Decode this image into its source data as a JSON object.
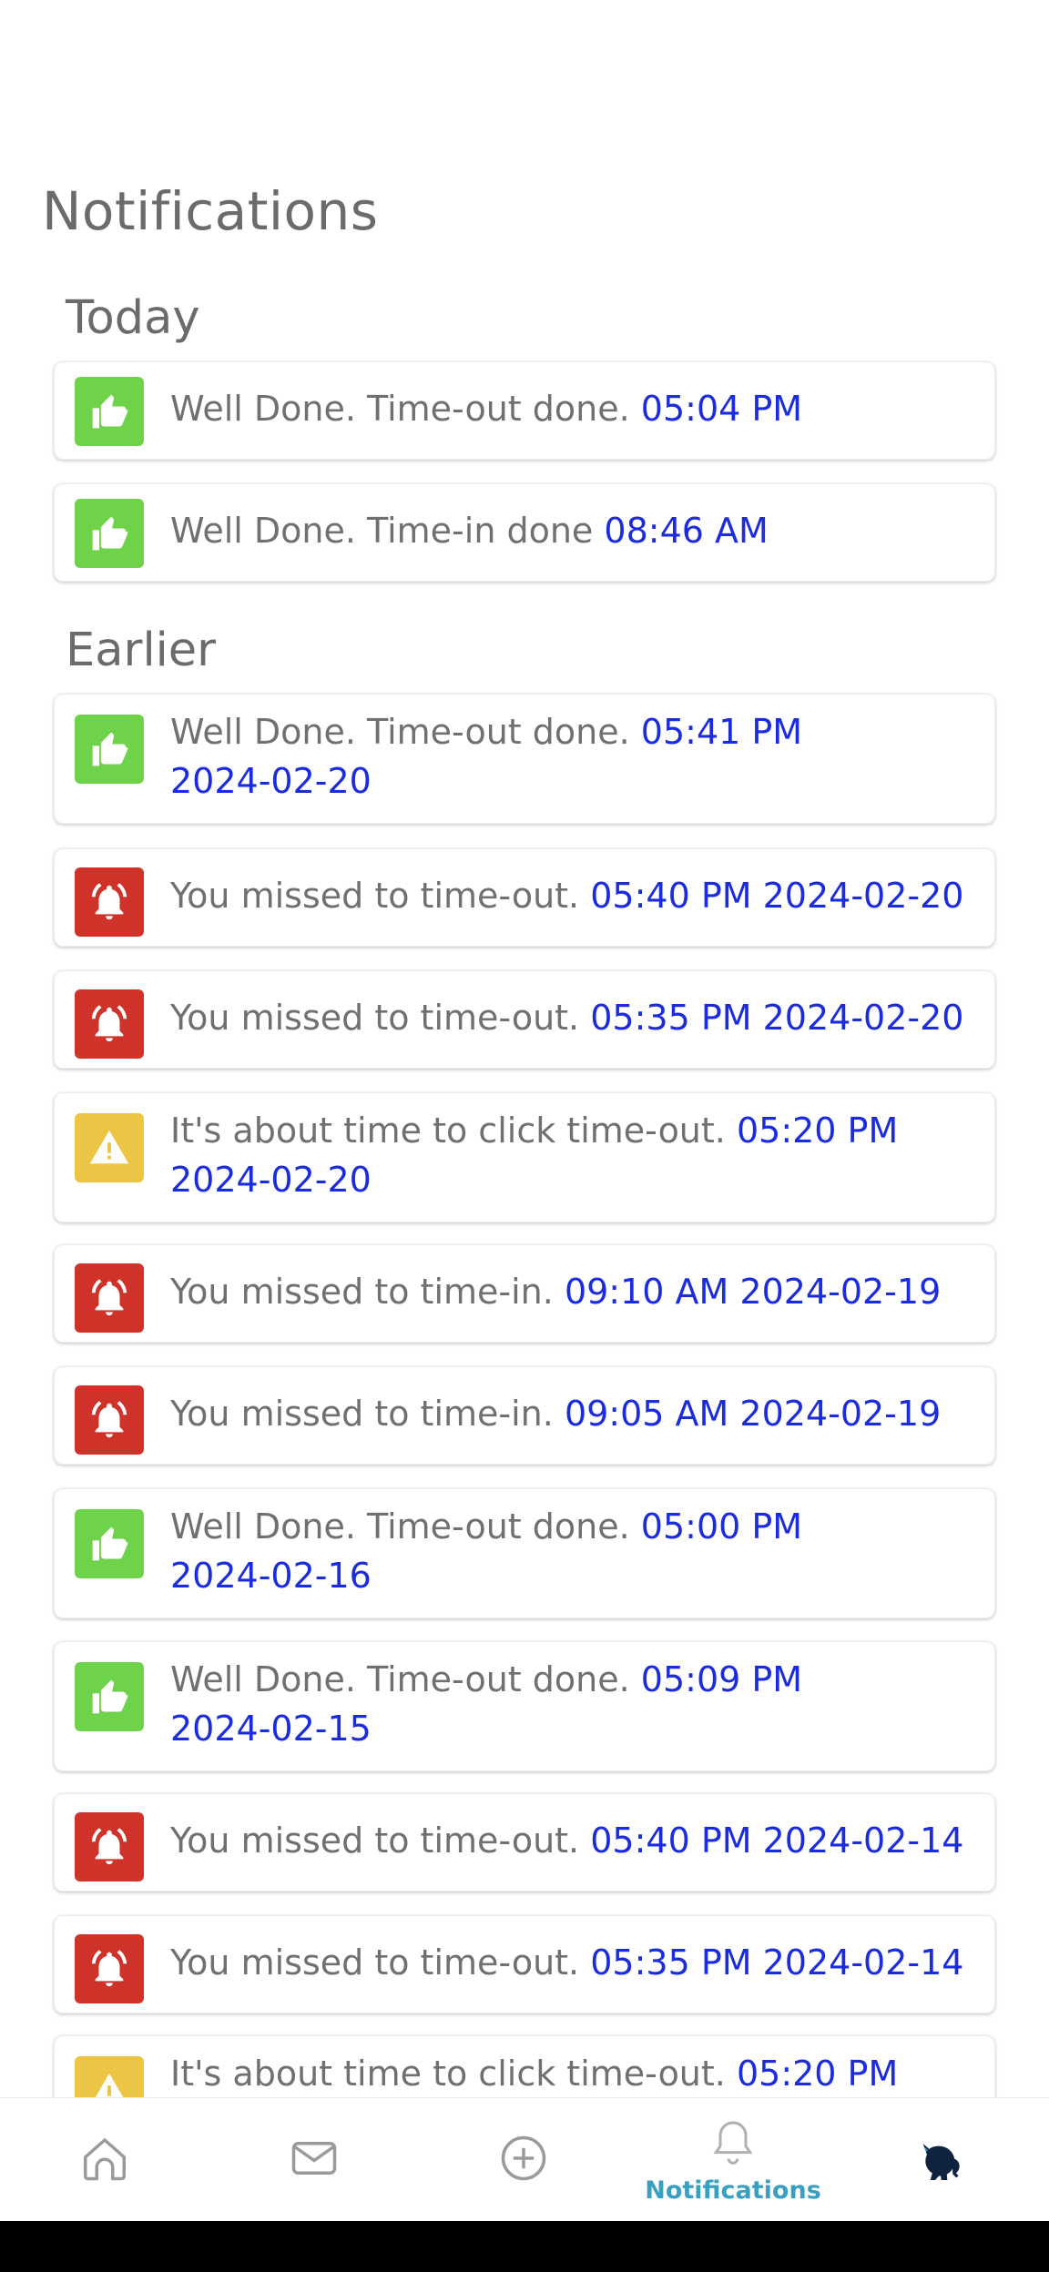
{
  "page": {
    "title": "Notifications"
  },
  "sections": {
    "today": "Today",
    "earlier": "Earlier"
  },
  "today_items": [
    {
      "type": "success",
      "icon": "thumbs-up-icon",
      "message": "Well Done. Time-out done.",
      "time": "05:04 PM"
    },
    {
      "type": "success",
      "icon": "thumbs-up-icon",
      "message": "Well Done. Time-in done",
      "time": "08:46 AM"
    }
  ],
  "earlier_items": [
    {
      "type": "success",
      "icon": "thumbs-up-icon",
      "message": "Well Done. Time-out done.",
      "time": "05:41 PM",
      "date": "2024-02-20"
    },
    {
      "type": "missed",
      "icon": "alarm-bell-icon",
      "message": "You missed to time-out.",
      "time": "05:40 PM",
      "date": "2024-02-20"
    },
    {
      "type": "missed",
      "icon": "alarm-bell-icon",
      "message": "You missed to time-out.",
      "time": "05:35 PM",
      "date": "2024-02-20"
    },
    {
      "type": "warning",
      "icon": "warning-icon",
      "message": "It's about time to click time-out.",
      "time": "05:20 PM",
      "date": "2024-02-20"
    },
    {
      "type": "missed",
      "icon": "alarm-bell-icon",
      "message": "You missed to time-in.",
      "time": "09:10 AM",
      "date": "2024-02-19"
    },
    {
      "type": "missed",
      "icon": "alarm-bell-icon",
      "message": "You missed to time-in.",
      "time": "09:05 AM",
      "date": "2024-02-19"
    },
    {
      "type": "success",
      "icon": "thumbs-up-icon",
      "message": "Well Done. Time-out done.",
      "time": "05:00 PM",
      "date": "2024-02-16"
    },
    {
      "type": "success",
      "icon": "thumbs-up-icon",
      "message": "Well Done. Time-out done.",
      "time": "05:09 PM",
      "date": "2024-02-15"
    },
    {
      "type": "missed",
      "icon": "alarm-bell-icon",
      "message": "You missed to time-out.",
      "time": "05:40 PM",
      "date": "2024-02-14"
    },
    {
      "type": "missed",
      "icon": "alarm-bell-icon",
      "message": "You missed to time-out.",
      "time": "05:35 PM",
      "date": "2024-02-14"
    },
    {
      "type": "warning",
      "icon": "warning-icon",
      "message": "It's about time to click time-out.",
      "time": "05:20 PM",
      "date": ""
    }
  ],
  "bottom_nav": {
    "items": [
      {
        "id": "home",
        "icon": "home-icon",
        "label": ""
      },
      {
        "id": "messages",
        "icon": "mail-icon",
        "label": ""
      },
      {
        "id": "add",
        "icon": "plus-circle-icon",
        "label": ""
      },
      {
        "id": "notifications",
        "icon": "bell-icon",
        "label": "Notifications",
        "active": true
      },
      {
        "id": "profile",
        "icon": "cat-avatar-icon",
        "label": ""
      }
    ]
  },
  "colors": {
    "success": "#6fd34a",
    "missed": "#cf3228",
    "warning": "#ecc545",
    "time_text": "#1a2be0",
    "active_nav": "#3aa0c2"
  }
}
